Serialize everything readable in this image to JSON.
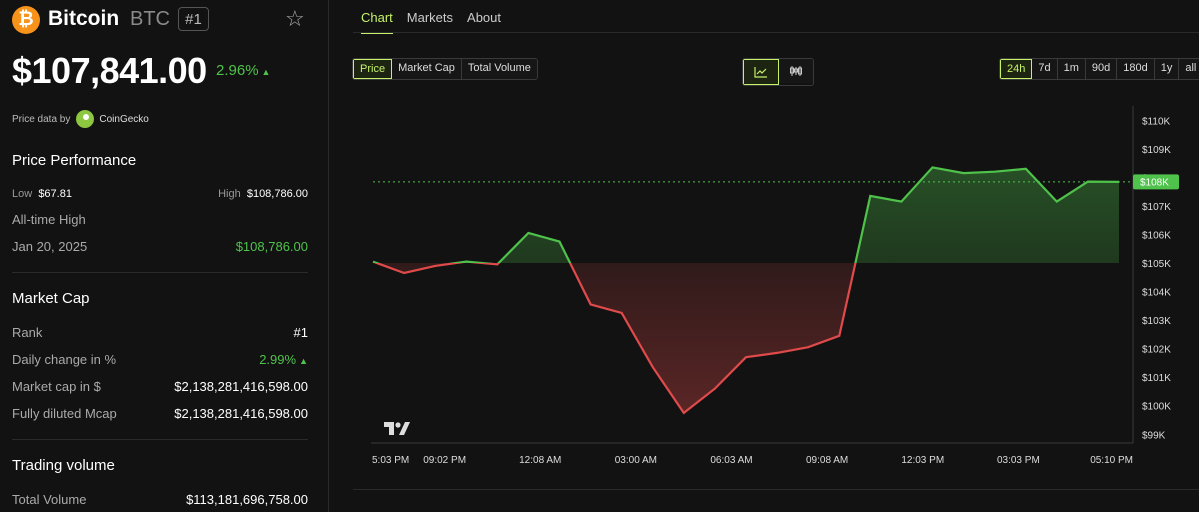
{
  "coin": {
    "logo_symbol": "₿",
    "name": "Bitcoin",
    "symbol": "BTC",
    "rank_badge": "#1",
    "price": "$107,841.00",
    "change_24h": "2.96%",
    "change_direction": "up"
  },
  "price_data": {
    "label": "Price data by",
    "provider": "CoinGecko"
  },
  "performance": {
    "title": "Price Performance",
    "low_label": "Low",
    "low_value": "$67.81",
    "high_label": "High",
    "high_value": "$108,786.00",
    "ath_label": "All-time High",
    "ath_date": "Jan 20, 2025",
    "ath_value": "$108,786.00"
  },
  "market_cap": {
    "title": "Market Cap",
    "rows": [
      {
        "label": "Rank",
        "value": "#1"
      },
      {
        "label": "Daily change in %",
        "value": "2.99%"
      },
      {
        "label": "Market cap in $",
        "value": "$2,138,281,416,598.00"
      },
      {
        "label": "Fully diluted Mcap",
        "value": "$2,138,281,416,598.00"
      }
    ]
  },
  "trading_volume": {
    "title": "Trading volume",
    "rows": [
      {
        "label": "Total Volume",
        "value": "$113,181,696,758.00"
      }
    ]
  },
  "tabs": [
    {
      "label": "Chart",
      "active": true
    },
    {
      "label": "Markets",
      "active": false
    },
    {
      "label": "About",
      "active": false
    }
  ],
  "metric_buttons": [
    {
      "label": "Price",
      "active": true
    },
    {
      "label": "Market Cap",
      "active": false
    },
    {
      "label": "Total Volume",
      "active": false
    }
  ],
  "chart_type_buttons": [
    {
      "icon": "line-chart-icon",
      "active": true
    },
    {
      "icon": "candlestick-icon",
      "active": false
    }
  ],
  "range_buttons": [
    {
      "label": "24h",
      "active": true
    },
    {
      "label": "7d",
      "active": false
    },
    {
      "label": "1m",
      "active": false
    },
    {
      "label": "90d",
      "active": false
    },
    {
      "label": "180d",
      "active": false
    },
    {
      "label": "1y",
      "active": false
    },
    {
      "label": "all",
      "active": false
    }
  ],
  "colors": {
    "accent": "#c6f26a",
    "up": "#4fc24b",
    "down": "#e04a4a",
    "bitcoin": "#f7931a"
  },
  "chart_data": {
    "type": "area",
    "ylabel": "",
    "xlabel": "",
    "ylim": [
      98800,
      110500
    ],
    "y_ticks": [
      "$99K",
      "$100K",
      "$101K",
      "$102K",
      "$103K",
      "$104K",
      "$105K",
      "$106K",
      "$107K",
      "$108K",
      "$109K",
      "$110K"
    ],
    "y_tick_values": [
      99000,
      100000,
      101000,
      102000,
      103000,
      104000,
      105000,
      106000,
      107000,
      108000,
      109000,
      110000
    ],
    "x_ticks": [
      "5:03 PM",
      "09:02 PM",
      "12:08 AM",
      "03:00 AM",
      "06:03 AM",
      "09:08 AM",
      "12:03 PM",
      "03:03 PM",
      "05:10 PM"
    ],
    "baseline": 105000,
    "current_label": "$108K",
    "current_value": 107841,
    "series": [
      {
        "x_hours": [
          0,
          1,
          2,
          3,
          4,
          5,
          6,
          7,
          8,
          9,
          10,
          11,
          12,
          13,
          14,
          15,
          16,
          17,
          18,
          19,
          20,
          21,
          22,
          23,
          24
        ],
        "values": [
          105050,
          104650,
          104900,
          105050,
          104950,
          106050,
          105750,
          103550,
          103250,
          101350,
          99750,
          100600,
          101700,
          101850,
          102050,
          102450,
          107350,
          107150,
          108350,
          108150,
          108200,
          108300,
          107150,
          107850,
          107841
        ]
      }
    ]
  }
}
